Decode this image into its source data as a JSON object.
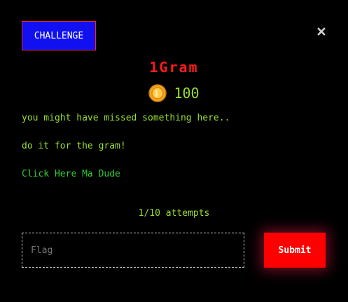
{
  "modal": {
    "category_label": "CHALLENGE",
    "close_icon": "close-icon",
    "title": "1Gram",
    "coin_icon": "coin-icon",
    "points": "100",
    "description_lines": [
      "you might have missed something here..",
      "do it for the gram!"
    ],
    "link_text": "Click Here Ma Dude",
    "attempts": "1/10 attempts",
    "flag_placeholder": "Flag",
    "submit_label": "Submit"
  },
  "colors": {
    "background": "#000000",
    "category_bg": "#1010f0",
    "category_border": "#ff2020",
    "title": "#ff1a1a",
    "text": "#9adf2a",
    "link": "#2ecc2e",
    "submit_bg": "#ff0000",
    "coin": "#f0a020"
  }
}
